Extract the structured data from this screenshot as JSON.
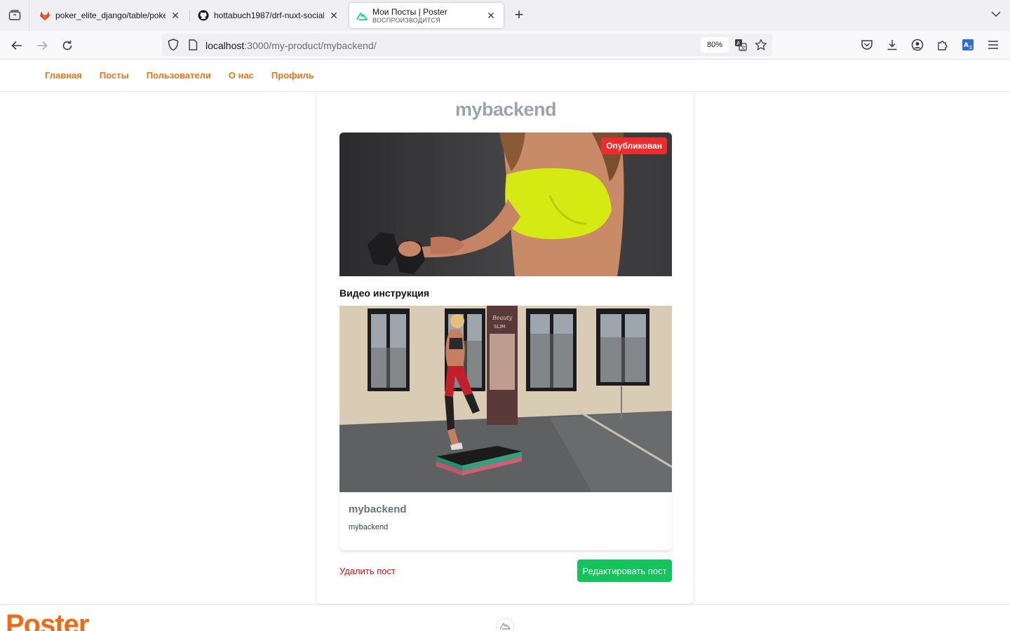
{
  "browser": {
    "tabs": [
      {
        "title": "poker_elite_django/table/poker_",
        "favicon": "gitlab-icon",
        "active": false
      },
      {
        "title": "hottabuch1987/drf-nuxt-social",
        "favicon": "github-icon",
        "active": false
      },
      {
        "title": "Мои Посты | Poster",
        "subtitle": "ВОСПРОИЗВОДИТСЯ",
        "favicon": "nuxt-icon",
        "active": true
      }
    ],
    "url": {
      "host": "localhost",
      "path": ":3000/my-product/mybackend/"
    },
    "zoom": "80%"
  },
  "site": {
    "nav": [
      "Главная",
      "Посты",
      "Пользователи",
      "О нас",
      "Профиль"
    ],
    "accent": "#f5730f"
  },
  "post": {
    "title": "mybackend",
    "status": "Опубликован",
    "video_heading": "Видео инструкция",
    "card_title": "mybackend",
    "card_description": "mybackend",
    "delete_label": "Удалить пост",
    "edit_label": "Редактировать пост"
  },
  "footer": {
    "logo": "Poster"
  },
  "colors": {
    "status_red": "#ef2b2b",
    "edit_green": "#12c55a",
    "delete_red": "#e30b0b"
  }
}
